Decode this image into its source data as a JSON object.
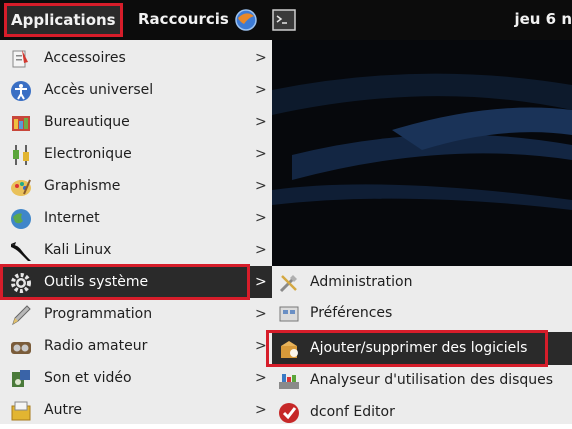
{
  "panel": {
    "applications_label": "Applications",
    "raccourcis_label": "Raccourcis",
    "clock_text": "jeu 6 n"
  },
  "menu": {
    "items": [
      {
        "label": "Accessoires",
        "icon": "accessories-icon"
      },
      {
        "label": "Accès universel",
        "icon": "accessibility-icon"
      },
      {
        "label": "Bureautique",
        "icon": "office-icon"
      },
      {
        "label": "Electronique",
        "icon": "electronics-icon"
      },
      {
        "label": "Graphisme",
        "icon": "graphics-icon"
      },
      {
        "label": "Internet",
        "icon": "internet-icon"
      },
      {
        "label": "Kali Linux",
        "icon": "kali-dragon-icon"
      },
      {
        "label": "Outils système",
        "icon": "gear-icon"
      },
      {
        "label": "Programmation",
        "icon": "pen-icon"
      },
      {
        "label": "Radio amateur",
        "icon": "radio-icon"
      },
      {
        "label": "Son et vidéo",
        "icon": "multimedia-icon"
      },
      {
        "label": "Autre",
        "icon": "other-icon"
      }
    ],
    "arrow": ">"
  },
  "submenu": {
    "items": [
      {
        "label": "Administration",
        "icon": "tools-icon"
      },
      {
        "label": "Préférences",
        "icon": "preferences-icon"
      },
      {
        "label": "Ajouter/supprimer des logiciels",
        "icon": "software-icon"
      },
      {
        "label": "Analyseur d'utilisation des disques",
        "icon": "disk-usage-icon"
      },
      {
        "label": "dconf Editor",
        "icon": "dconf-icon"
      }
    ]
  },
  "colors": {
    "highlight_red": "#d61d2a",
    "active_bg": "#2a2a2a",
    "menu_bg": "#ececec"
  }
}
